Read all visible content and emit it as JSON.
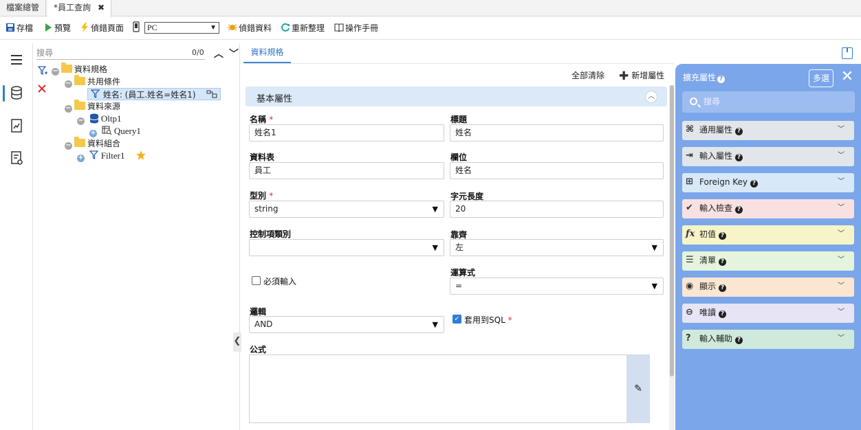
{
  "tabs": [
    {
      "label": "檔案總管"
    },
    {
      "label": "*員工查詢",
      "close": "✖"
    }
  ],
  "toolbar": {
    "save": "存檔",
    "preview": "預覽",
    "debug_page": "偵錯頁面",
    "device_value": "PC",
    "debug_data": "偵錯資料",
    "refresh": "重新整理",
    "manual": "操作手冊"
  },
  "tree": {
    "search_placeholder": "搜尋",
    "count": "0/0",
    "root": "資料規格",
    "shared": "共用條件",
    "selected_node": "姓名: (員工.姓名=姓名1)",
    "source": "資料來源",
    "oltp": "Oltp1",
    "query": "Query1",
    "combo": "資料組合",
    "filter": "Filter1"
  },
  "main": {
    "tab": "資料規格",
    "clear_all": "全部清除",
    "add_attr": "新增屬性",
    "section": "基本屬性",
    "fields": {
      "name_label": "名稱",
      "name_value": "姓名1",
      "title_label": "標題",
      "title_value": "姓名",
      "table_label": "資料表",
      "table_value": "員工",
      "column_label": "欄位",
      "column_value": "姓名",
      "type_label": "型別",
      "type_value": "string",
      "length_label": "字元長度",
      "length_value": "20",
      "control_label": "控制項類別",
      "control_value": "",
      "align_label": "靠齊",
      "align_value": "左",
      "required_label": "必須輸入",
      "operator_label": "運算式",
      "operator_value": "=",
      "logic_label": "邏輯",
      "logic_value": "AND",
      "apply_sql_label": "套用到SQL",
      "formula_label": "公式"
    },
    "required_mark": "*"
  },
  "panel": {
    "title": "擴充屬性",
    "multi": "多選",
    "search_placeholder": "搜尋",
    "groups": [
      {
        "icon": "⌘",
        "label": "通用屬性",
        "color": "#e2e6ea"
      },
      {
        "icon": "⇥",
        "label": "輸入屬性",
        "color": "#e2e6ea"
      },
      {
        "icon": "⊞",
        "label": "Foreign Key",
        "color": "#d7e8f8"
      },
      {
        "icon": "✔",
        "label": "輸入檢查",
        "color": "#f9e1e1"
      },
      {
        "icon": "fx",
        "label": "初值",
        "color": "#f7f4c8"
      },
      {
        "icon": "☰",
        "label": "清單",
        "color": "#e4f4dd"
      },
      {
        "icon": "◉",
        "label": "顯示",
        "color": "#fbe6d2"
      },
      {
        "icon": "⊖",
        "label": "唯讀",
        "color": "#e6e4f5"
      },
      {
        "icon": "?",
        "label": "輸入輔助",
        "color": "#cfeadc"
      }
    ]
  }
}
